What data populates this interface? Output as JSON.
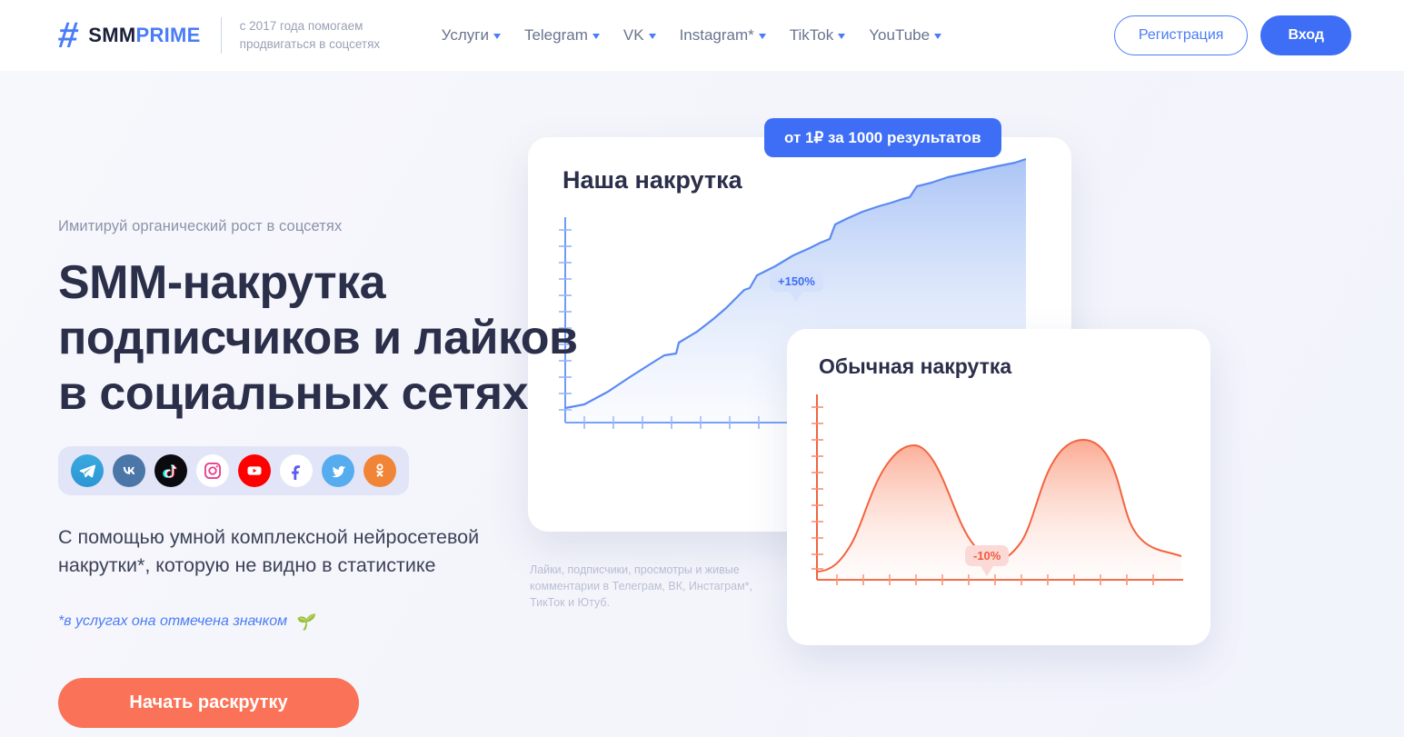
{
  "header": {
    "logo": {
      "hash": "#",
      "smm": "SMM",
      "prime": "PRIME"
    },
    "tagline": "с 2017 года помогаем продвигаться в соцсетях",
    "nav": [
      {
        "label": "Услуги",
        "has_caret": true
      },
      {
        "label": "Telegram",
        "has_caret": true
      },
      {
        "label": "VK",
        "has_caret": true
      },
      {
        "label": "Instagram*",
        "has_caret": true
      },
      {
        "label": "TikTok",
        "has_caret": true
      },
      {
        "label": "YouTube",
        "has_caret": true
      }
    ],
    "register_label": "Регистрация",
    "login_label": "Вход"
  },
  "hero": {
    "eyebrow": "Имитируй органический рост в соцсетях",
    "heading_line1": "SMM-накрутка",
    "heading_line2": "подписчиков и лайков",
    "heading_line3": "в социальных сетях",
    "body": "С помощью умной комплексной нейросетевой накрутки*, которую не видно в статистике",
    "note": "*в услугах она отмечена значком",
    "sprout_icon": "🌱",
    "cta_label": "Начать раскрутку",
    "behind_text": "Лайки, подписчики, просмотры и живые комментарии в Телеграм, ВК, Инстаграм*, ТикТок и Ютуб.",
    "socials": [
      {
        "name": "telegram"
      },
      {
        "name": "vk"
      },
      {
        "name": "tiktok"
      },
      {
        "name": "instagram"
      },
      {
        "name": "youtube"
      },
      {
        "name": "facebook"
      },
      {
        "name": "twitter"
      },
      {
        "name": "odnoklassniki"
      }
    ]
  },
  "cards": {
    "price_badge": "от 1₽ за 1000 результатов",
    "blue_title": "Наша накрутка",
    "orange_title": "Обычная накрутка",
    "blue_tooltip": "+150%",
    "orange_tooltip": "-10%"
  },
  "colors": {
    "brand_blue": "#3d6ef5",
    "link_blue": "#4a7cf7",
    "orange": "#f15a3c",
    "cta_orange": "#fa7358",
    "heading": "#2b2f4a",
    "page_bg": "#f5f6fb"
  },
  "chart_data": [
    {
      "type": "area",
      "title": "Наша накрутка",
      "annotation": "+150%",
      "series_name": "Наша накрутка",
      "axis_color": "#4a7cf7",
      "grid": false,
      "xlabel": "",
      "ylabel": "",
      "x": [
        0,
        1,
        2,
        3,
        4,
        5,
        6,
        7,
        8,
        9,
        10,
        11,
        12,
        13,
        14,
        15,
        16,
        17,
        18,
        19,
        20
      ],
      "values": [
        6,
        9,
        15,
        22,
        31,
        36,
        38,
        46,
        54,
        60,
        66,
        72,
        78,
        86,
        88,
        90,
        92,
        94,
        96,
        98,
        100
      ]
    },
    {
      "type": "area",
      "title": "Обычная накрутка",
      "annotation": "-10%",
      "series_name": "Обычная накрутка",
      "axis_color": "#f15a3c",
      "grid": false,
      "xlabel": "",
      "ylabel": "",
      "x": [
        0,
        1,
        2,
        3,
        4,
        5,
        6,
        7,
        8,
        9,
        10,
        11,
        12,
        13,
        14,
        15,
        16,
        17,
        18,
        19,
        20
      ],
      "values": [
        4,
        8,
        20,
        48,
        72,
        80,
        62,
        36,
        16,
        9,
        7,
        12,
        34,
        68,
        90,
        94,
        90,
        60,
        26,
        16,
        12
      ]
    }
  ]
}
